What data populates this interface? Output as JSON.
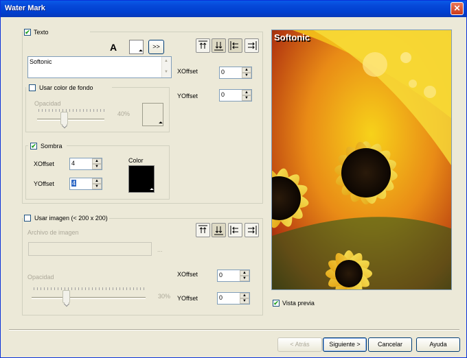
{
  "window": {
    "title": "Water Mark",
    "close_glyph": "✕"
  },
  "text_group": {
    "checkbox_label": "Texto",
    "checked": true,
    "font_glyph": "A",
    "more_button": ">>",
    "text_value": "Softonic",
    "xoffset_label": "XOffset",
    "xoffset_value": "0",
    "yoffset_label": "YOffset",
    "yoffset_value": "0"
  },
  "background_group": {
    "checkbox_label": "Usar color de fondo",
    "checked": false,
    "opacity_label": "Opacidad",
    "opacity_value": "40%"
  },
  "shadow_group": {
    "checkbox_label": "Sombra",
    "checked": true,
    "xoffset_label": "XOffset",
    "xoffset_value": "4",
    "yoffset_label": "YOffset",
    "yoffset_value": "4",
    "color_label": "Color",
    "color": "#000000"
  },
  "image_group": {
    "checkbox_label": "Usar imagen (< 200 x 200)",
    "checked": false,
    "file_label": "Archivo de imagen",
    "browse_label": "...",
    "opacity_label": "Opacidad",
    "opacity_value": "30%",
    "xoffset_label": "XOffset",
    "xoffset_value": "0",
    "yoffset_label": "YOffset",
    "yoffset_value": "0"
  },
  "preview": {
    "watermark_text": "Softonic",
    "checkbox_label": "Vista previa",
    "checked": true
  },
  "footer": {
    "back": "< Atrás",
    "next": "Siguiente >",
    "cancel": "Cancelar",
    "help": "Ayuda"
  },
  "colors": {
    "titlebar": "#0a5ae8",
    "dialog_bg": "#ece9d8",
    "check": "#21a121"
  }
}
